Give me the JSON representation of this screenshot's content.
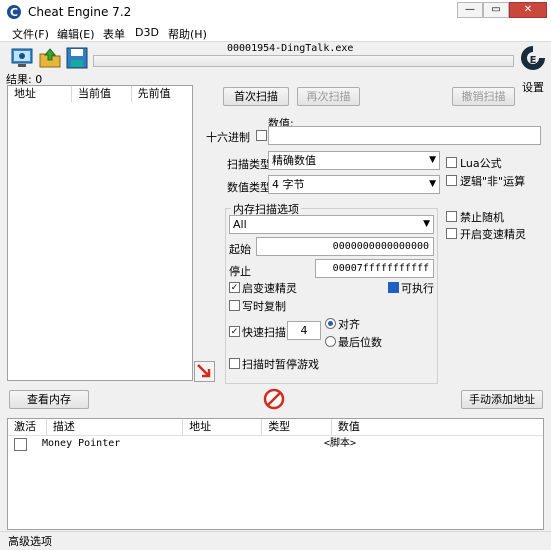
{
  "window": {
    "title": "Cheat Engine 7.2",
    "min": "—",
    "max": "▭",
    "close": "✕"
  },
  "menu": [
    "文件(F)",
    "编辑(E)",
    "表单",
    "D3D",
    "帮助(H)"
  ],
  "process_name": "00001954-DingTalk.exe",
  "settings_label": "设置",
  "results_label": "结果: 0",
  "results_headers": [
    "地址",
    "当前值",
    "先前值"
  ],
  "buttons": {
    "first_scan": "首次扫描",
    "next_scan": "再次扫描",
    "undo_scan": "撤销扫描",
    "view_memory": "查看内存",
    "add_address": "手动添加地址"
  },
  "value": {
    "label": "数值:",
    "hex_label": "十六进制",
    "input": ""
  },
  "scan_type": {
    "label": "扫描类型",
    "value": "精确数值"
  },
  "value_type": {
    "label": "数值类型",
    "value": "4 字节"
  },
  "mem_options": {
    "title": "内存扫描选项",
    "region": "All",
    "start_label": "起始",
    "start_value": "0000000000000000",
    "stop_label": "停止",
    "stop_value": "00007fffffffffff",
    "writable_label": "启变速精灵",
    "cow_label": "写时复制",
    "executable_label": "可执行",
    "fast_scan_label": "快速扫描",
    "fast_scan_value": "4",
    "align_label": "对齐",
    "last_digits_label": "最后位数",
    "pause_label": "扫描时暂停游戏"
  },
  "right_options": {
    "lua": "Lua公式",
    "not_logic": "逻辑\"非\"运算",
    "no_random": "禁止随机",
    "speedhack": "开启变速精灵"
  },
  "cheat_table": {
    "headers": [
      "激活",
      "描述",
      "地址",
      "类型",
      "数值"
    ],
    "rows": [
      {
        "description": "Money Pointer",
        "address": "",
        "type": "",
        "value": "<脚本>"
      }
    ]
  },
  "advanced_label": "高级选项",
  "colors": {
    "accent": "#1e5fbf",
    "close": "#c9483d",
    "arrow": "#d32a1f"
  }
}
